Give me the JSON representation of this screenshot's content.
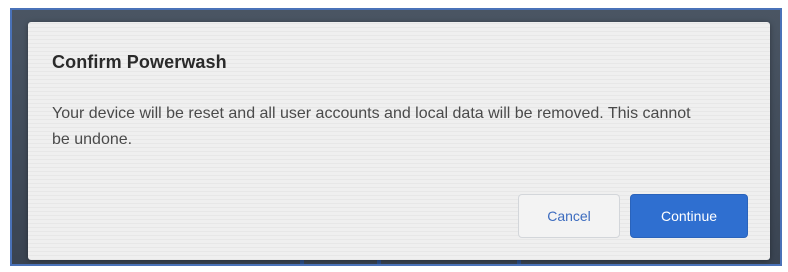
{
  "dialog": {
    "title": "Confirm Powerwash",
    "body": "Your device will be reset and all user accounts and local data will be removed. This cannot be undone.",
    "cancel_label": "Cancel",
    "continue_label": "Continue"
  },
  "colors": {
    "accent": "#2f6fd0",
    "cancel_text": "#3d6cbf",
    "dialog_bg": "#efefef"
  }
}
